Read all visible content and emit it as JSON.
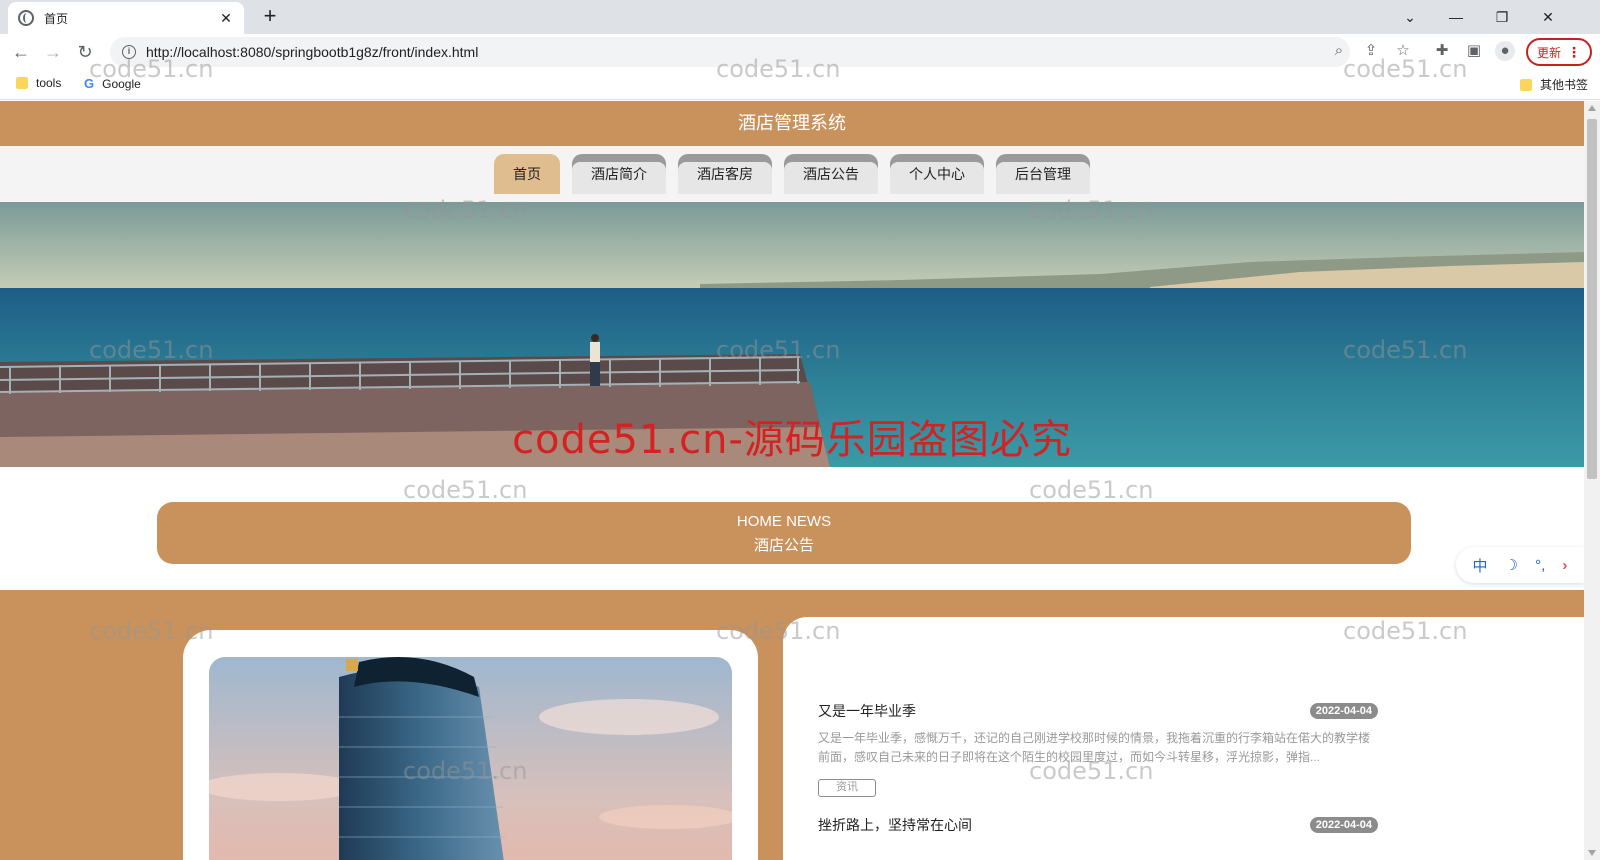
{
  "browser": {
    "tab_title": "首页",
    "tab_close": "✕",
    "new_tab": "+",
    "url": "http://localhost:8080/springbootb1g8z/front/index.html",
    "update_label": "更新",
    "bookmarks": [
      {
        "label": "tools",
        "icon": "folder-icon"
      },
      {
        "label": "Google",
        "icon": "google-icon"
      }
    ],
    "other_bookmarks": "其他书签"
  },
  "site": {
    "title": "酒店管理系统",
    "nav": [
      {
        "label": "首页",
        "active": true
      },
      {
        "label": "酒店简介",
        "active": false
      },
      {
        "label": "酒店客房",
        "active": false
      },
      {
        "label": "酒店公告",
        "active": false
      },
      {
        "label": "个人中心",
        "active": false
      },
      {
        "label": "后台管理",
        "active": false
      }
    ],
    "banner_text": "code51.cn-源码乐园盗图必究",
    "news_section": {
      "title_en": "HOME NEWS",
      "title_cn": "酒店公告",
      "items": [
        {
          "title": "又是一年毕业季",
          "date": "2022-04-04",
          "text": "又是一年毕业季，感慨万千，还记的自己刚进学校那时候的情景，我拖着沉重的行李箱站在偌大的教学楼前面，感叹自己未来的日子即将在这个陌生的校园里度过，而如今斗转星移，浮光掠影，弹指...",
          "tag": "资讯"
        },
        {
          "title": "挫折路上，坚持常在心间",
          "date": "2022-04-04",
          "text": "",
          "tag": ""
        }
      ]
    }
  },
  "lang_widget": {
    "lang": "中",
    "moon": "☽",
    "dots": "°,",
    "arrow": "›"
  },
  "watermark": "code51.cn",
  "colors": {
    "brand": "#c9925c",
    "nav_active": "#e0bd8e",
    "banner_watermark": "#d42222"
  }
}
